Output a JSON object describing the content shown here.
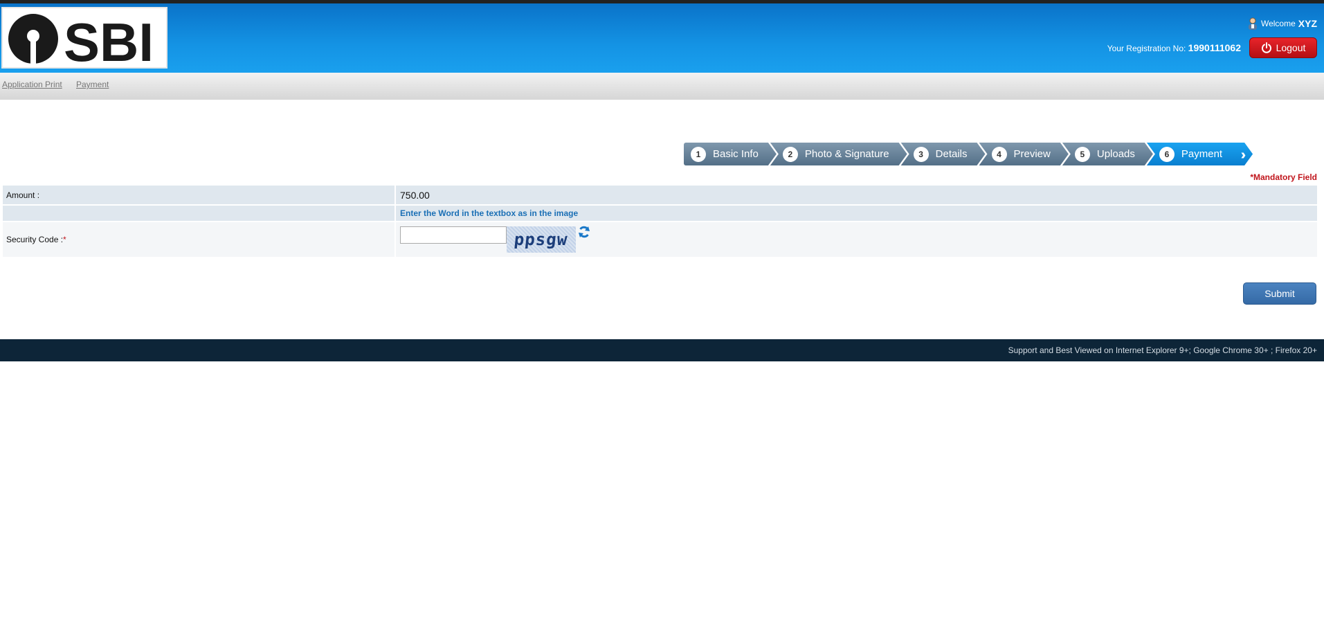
{
  "header": {
    "logo_text": "SBI",
    "welcome_label": "Welcome",
    "user_name": "XYZ",
    "registration_label": "Your Registration No:",
    "registration_no": "1990111062",
    "logout_label": "Logout"
  },
  "nav": {
    "items": [
      {
        "label": "Application Print"
      },
      {
        "label": "Payment"
      }
    ]
  },
  "steps": [
    {
      "num": "1",
      "label": "Basic Info"
    },
    {
      "num": "2",
      "label": "Photo & Signature"
    },
    {
      "num": "3",
      "label": "Details"
    },
    {
      "num": "4",
      "label": "Preview"
    },
    {
      "num": "5",
      "label": "Uploads"
    },
    {
      "num": "6",
      "label": "Payment",
      "active": true
    }
  ],
  "form": {
    "mandatory_note": "*Mandatory Field",
    "amount_label": "Amount :",
    "amount_value": "750.00",
    "captcha_hint": "Enter the Word in the textbox as in the image",
    "security_label": "Security Code :",
    "required_marker": "*",
    "security_value": "",
    "captcha_text": "ppsgw",
    "submit_label": "Submit"
  },
  "footer": {
    "text": "Support and Best Viewed on Internet Explorer 9+; Google Chrome 30+ ; Firefox 20+"
  },
  "colors": {
    "header_blue": "#1493e4",
    "logout_red": "#d01a20",
    "step_active": "#1aa3f0",
    "step_inactive": "#536f87",
    "footer_bg": "#0d2538"
  }
}
